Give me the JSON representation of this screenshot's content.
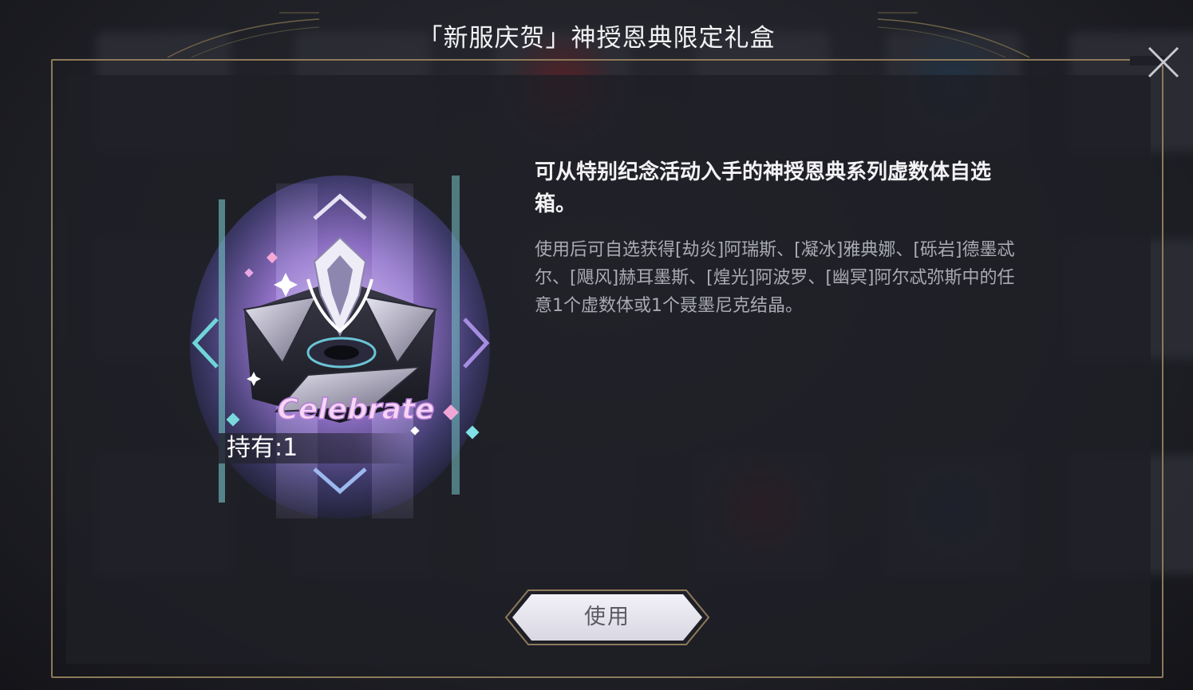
{
  "dialog": {
    "title": "「新服庆贺」神授恩典限定礼盒",
    "close_icon": "close-icon"
  },
  "item": {
    "icon": "gift-box-icon",
    "badge_text": "Celebrate",
    "hold_count": "持有:1"
  },
  "description": {
    "headline": "可从特别纪念活动入手的神授恩典系列虚数体自选箱。",
    "body": "使用后可自选获得[劫炎]阿瑞斯、[凝冰]雅典娜、[砾岩]德墨忒尔、[飓风]赫耳墨斯、[煌光]阿波罗、[幽冥]阿尔忒弥斯中的任意1个虚数体或1个聂墨尼克结晶。"
  },
  "actions": {
    "use_label": "使用"
  },
  "colors": {
    "frame_gold": "#8c7a5a",
    "panel_bg": "#1e1f26",
    "text_primary": "#f3f3f5",
    "text_secondary": "#a9abb3"
  }
}
